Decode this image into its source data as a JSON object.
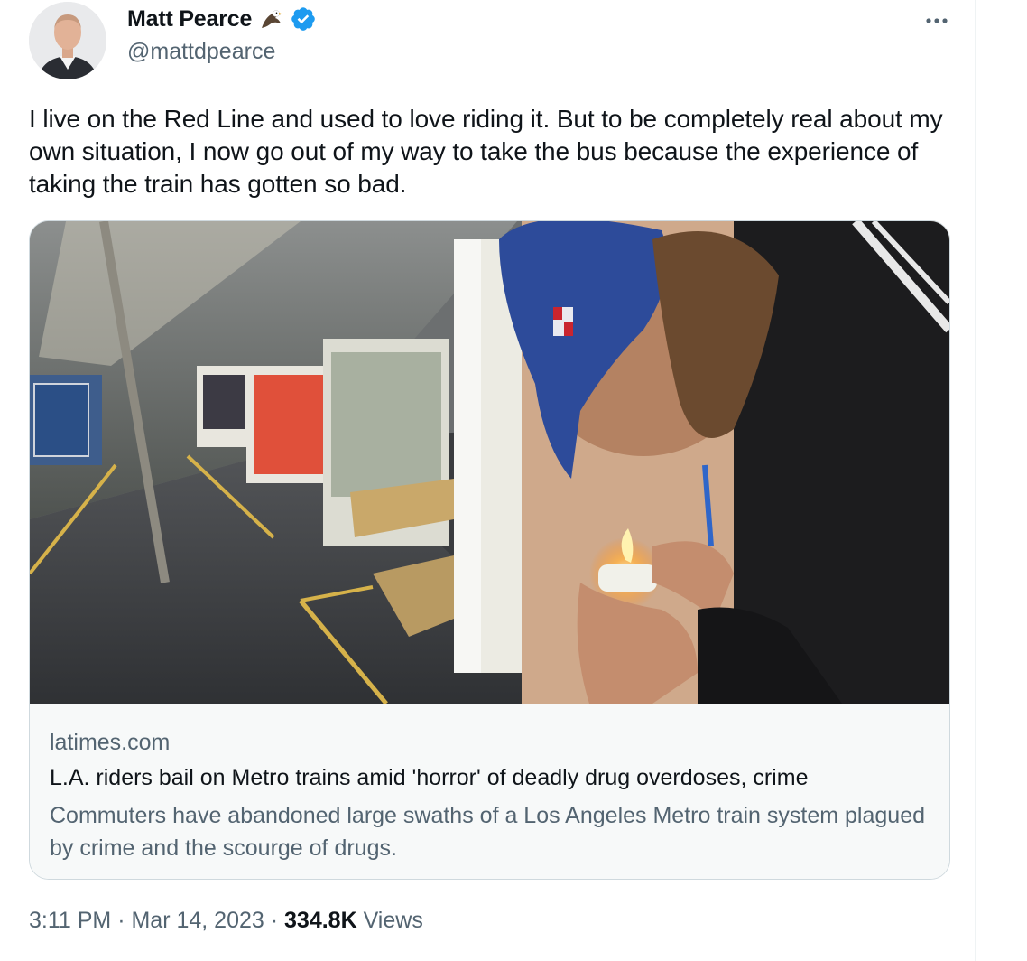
{
  "author": {
    "display_name": "Matt Pearce",
    "handle": "@mattdpearce",
    "verified_color": "#1d9bf0"
  },
  "tweet": {
    "text": "I live on the Red Line and used to love riding it. But to be completely real about my own situation, I now go out of my way to take the bus because the experience of taking the train has gotten so bad."
  },
  "link_card": {
    "domain": "latimes.com",
    "title": "L.A. riders bail on Metro trains amid 'horror' of deadly drug overdoses, crime",
    "description": "Commuters have abandoned large swaths of a Los Angeles Metro train system plagued by crime and the scourge of drugs."
  },
  "meta": {
    "time": "3:11 PM",
    "separator_1": " · ",
    "date": "Mar 14, 2023",
    "separator_2": " · ",
    "views_count": "334.8K",
    "views_label": " Views"
  },
  "icons": [
    "eagle-icon",
    "verified-badge-icon",
    "more-options-icon"
  ]
}
